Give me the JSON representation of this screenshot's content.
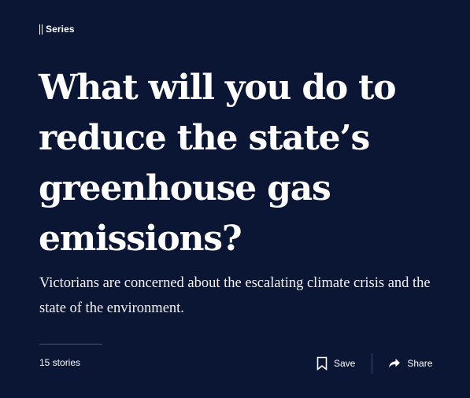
{
  "series_tag": {
    "label": "Series"
  },
  "headline": "What will you do to reduce the state’s greenhouse gas emissions?",
  "subhead": "Victorians are concerned about the escalating climate crisis and the state of the environment.",
  "footer": {
    "stories_count": "15 stories",
    "save_label": "Save",
    "share_label": "Share"
  },
  "icons": {
    "series": "series-bars-icon",
    "save": "bookmark-icon",
    "share": "share-arrow-icon"
  },
  "colors": {
    "background": "#0b1634",
    "text": "#ffffff"
  }
}
